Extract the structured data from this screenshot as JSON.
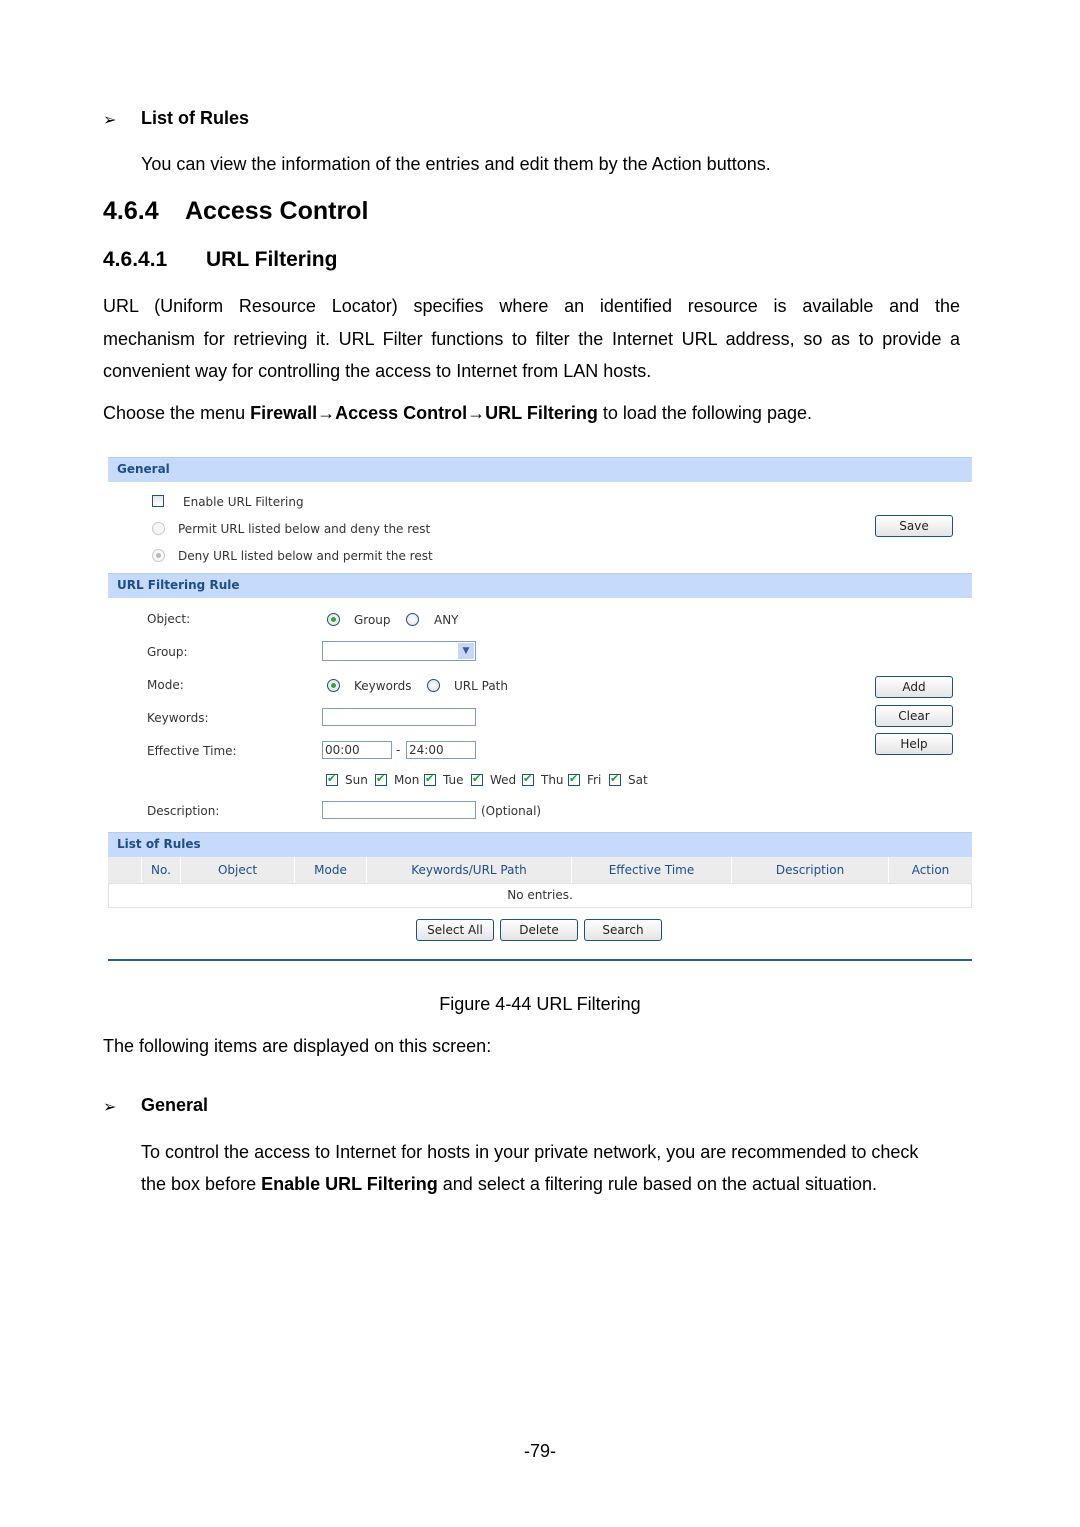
{
  "doc": {
    "list_of_rules_heading": "List of Rules",
    "list_of_rules_text": "You can view the information of the entries and edit them by the Action buttons.",
    "section_number": "4.6.4",
    "section_title": "Access Control",
    "subsection_number": "4.6.4.1",
    "subsection_title": "URL Filtering",
    "para1_line1": "URL (Uniform Resource Locator) specifies where an identified resource is available and the",
    "para1_line2": "mechanism for retrieving it. URL Filter functions to filter the Internet URL address, so as to provide a",
    "para1_line3": "convenient way for controlling the access to Internet from LAN hosts.",
    "menu_prefix": "Choose the menu ",
    "menu_path": "Firewall→Access Control→URL Filtering",
    "menu_suffix": " to load the following page.",
    "figure_caption": "Figure 4-44 URL Filtering",
    "items_intro": "The following items are displayed on this screen:",
    "general_heading": "General",
    "general_line1": "To control the access to Internet for hosts in your private network, you are recommended to check",
    "general_line2_prefix": "the box before ",
    "general_line2_bold": "Enable URL Filtering",
    "general_line2_suffix": " and select a filtering rule based on the actual situation.",
    "page_number": "-79-",
    "bullet_glyph": "➢"
  },
  "ui": {
    "general": {
      "title": "General",
      "enable_label": "Enable URL Filtering",
      "enable_checked": false,
      "permit_label": "Permit URL listed below and deny the rest",
      "deny_label": "Deny URL listed below and permit the rest",
      "selected_rule": "deny",
      "save_button": "Save"
    },
    "rule": {
      "title": "URL Filtering Rule",
      "object_label": "Object:",
      "object_options": [
        "Group",
        "ANY"
      ],
      "object_selected": "Group",
      "group_label": "Group:",
      "group_value": "",
      "mode_label": "Mode:",
      "mode_options": [
        "Keywords",
        "URL Path"
      ],
      "mode_selected": "Keywords",
      "keywords_label": "Keywords:",
      "keywords_value": "",
      "effective_time_label": "Effective Time:",
      "time_start": "00:00",
      "time_separator": "-",
      "time_end": "24:00",
      "days": [
        {
          "label": "Sun",
          "checked": true
        },
        {
          "label": "Mon",
          "checked": true
        },
        {
          "label": "Tue",
          "checked": true
        },
        {
          "label": "Wed",
          "checked": true
        },
        {
          "label": "Thu",
          "checked": true
        },
        {
          "label": "Fri",
          "checked": true
        },
        {
          "label": "Sat",
          "checked": true
        }
      ],
      "description_label": "Description:",
      "description_value": "",
      "description_hint": "(Optional)",
      "add_button": "Add",
      "clear_button": "Clear",
      "help_button": "Help"
    },
    "list": {
      "title": "List of Rules",
      "columns": [
        "",
        "No.",
        "Object",
        "Mode",
        "Keywords/URL Path",
        "Effective Time",
        "Description",
        "Action"
      ],
      "empty_text": "No entries.",
      "select_all_button": "Select All",
      "delete_button": "Delete",
      "search_button": "Search"
    }
  }
}
